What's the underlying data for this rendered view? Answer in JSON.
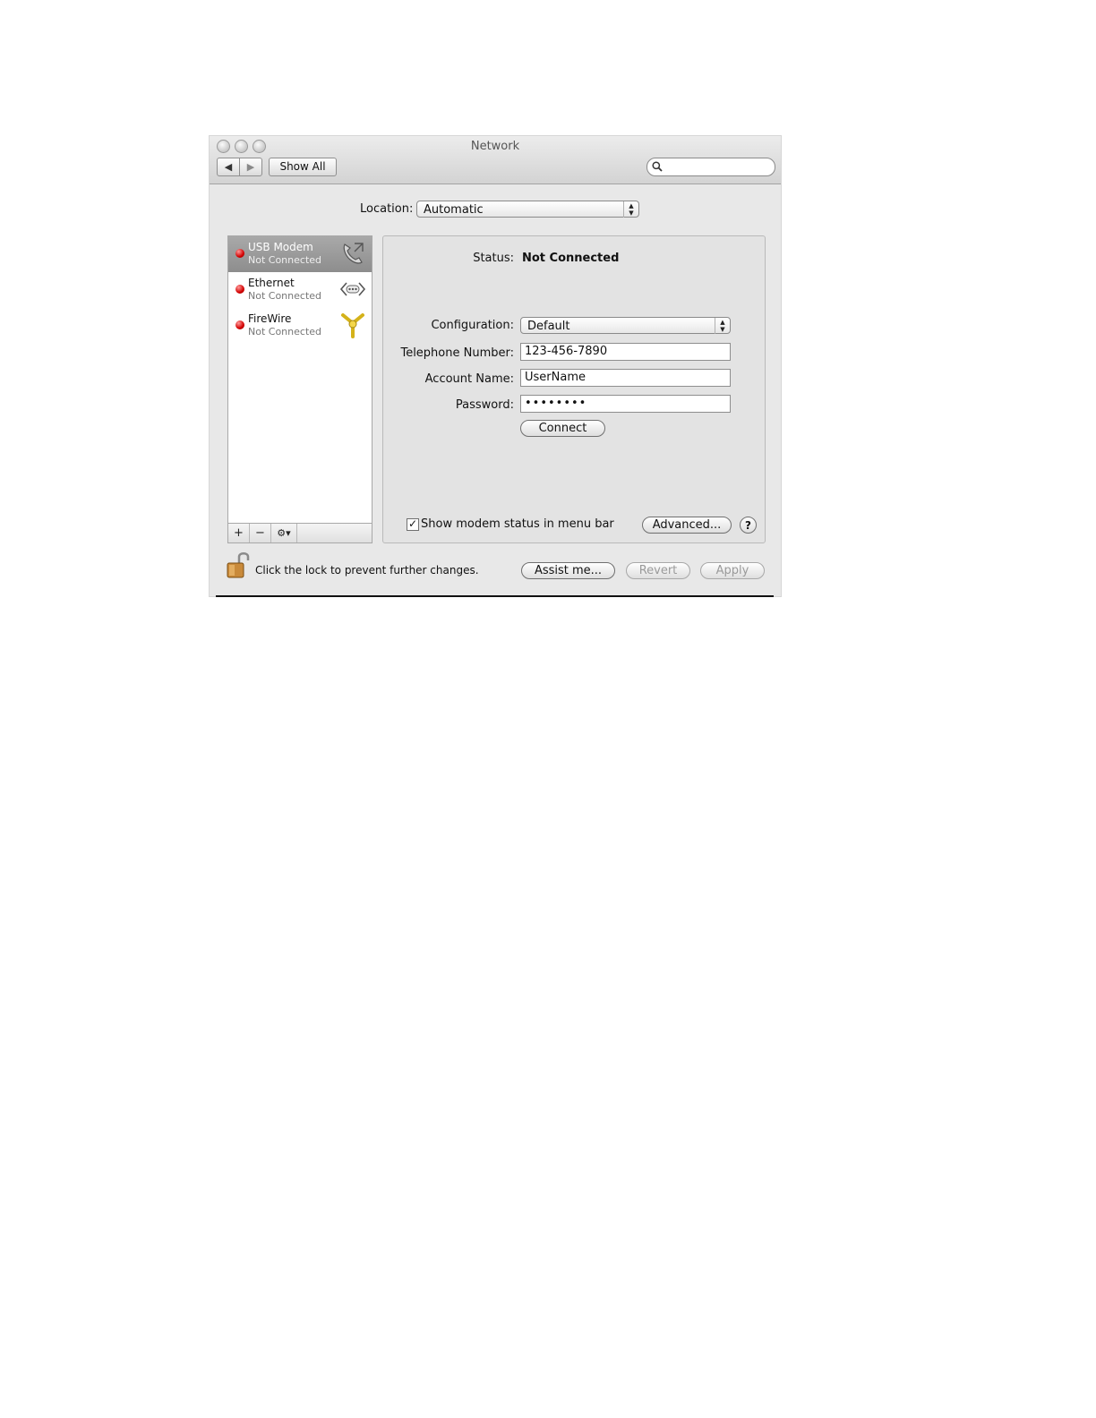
{
  "window": {
    "title": "Network"
  },
  "toolbar": {
    "back_glyph": "◀",
    "forward_glyph": "▶",
    "show_all_label": "Show All",
    "search_placeholder": "",
    "search_icon": "search-icon"
  },
  "location": {
    "label": "Location:",
    "value": "Automatic"
  },
  "services": [
    {
      "name": "USB Modem",
      "status": "Not Connected",
      "icon": "phone-modem-icon",
      "selected": true
    },
    {
      "name": "Ethernet",
      "status": "Not Connected",
      "icon": "ethernet-icon",
      "selected": false
    },
    {
      "name": "FireWire",
      "status": "Not Connected",
      "icon": "firewire-icon",
      "selected": false
    }
  ],
  "list_toolbar": {
    "add": "+",
    "remove": "−",
    "action": "⚙▾"
  },
  "detail": {
    "status_label": "Status:",
    "status_value": "Not Connected",
    "configuration_label": "Configuration:",
    "configuration_value": "Default",
    "telephone_label": "Telephone Number:",
    "telephone_value": "123-456-7890",
    "account_label": "Account Name:",
    "account_value": "UserName",
    "password_label": "Password:",
    "password_value": "••••••••",
    "connect_label": "Connect",
    "show_status_label": "Show modem status in menu bar",
    "show_status_checked": true,
    "advanced_label": "Advanced...",
    "help_label": "?"
  },
  "footer": {
    "lock_text": "Click the lock to prevent further changes.",
    "assist_label": "Assist me...",
    "revert_label": "Revert",
    "apply_label": "Apply"
  },
  "colors": {
    "status_dot": "#d30000",
    "selection": "#999999",
    "window_bg": "#e8e8e8"
  }
}
